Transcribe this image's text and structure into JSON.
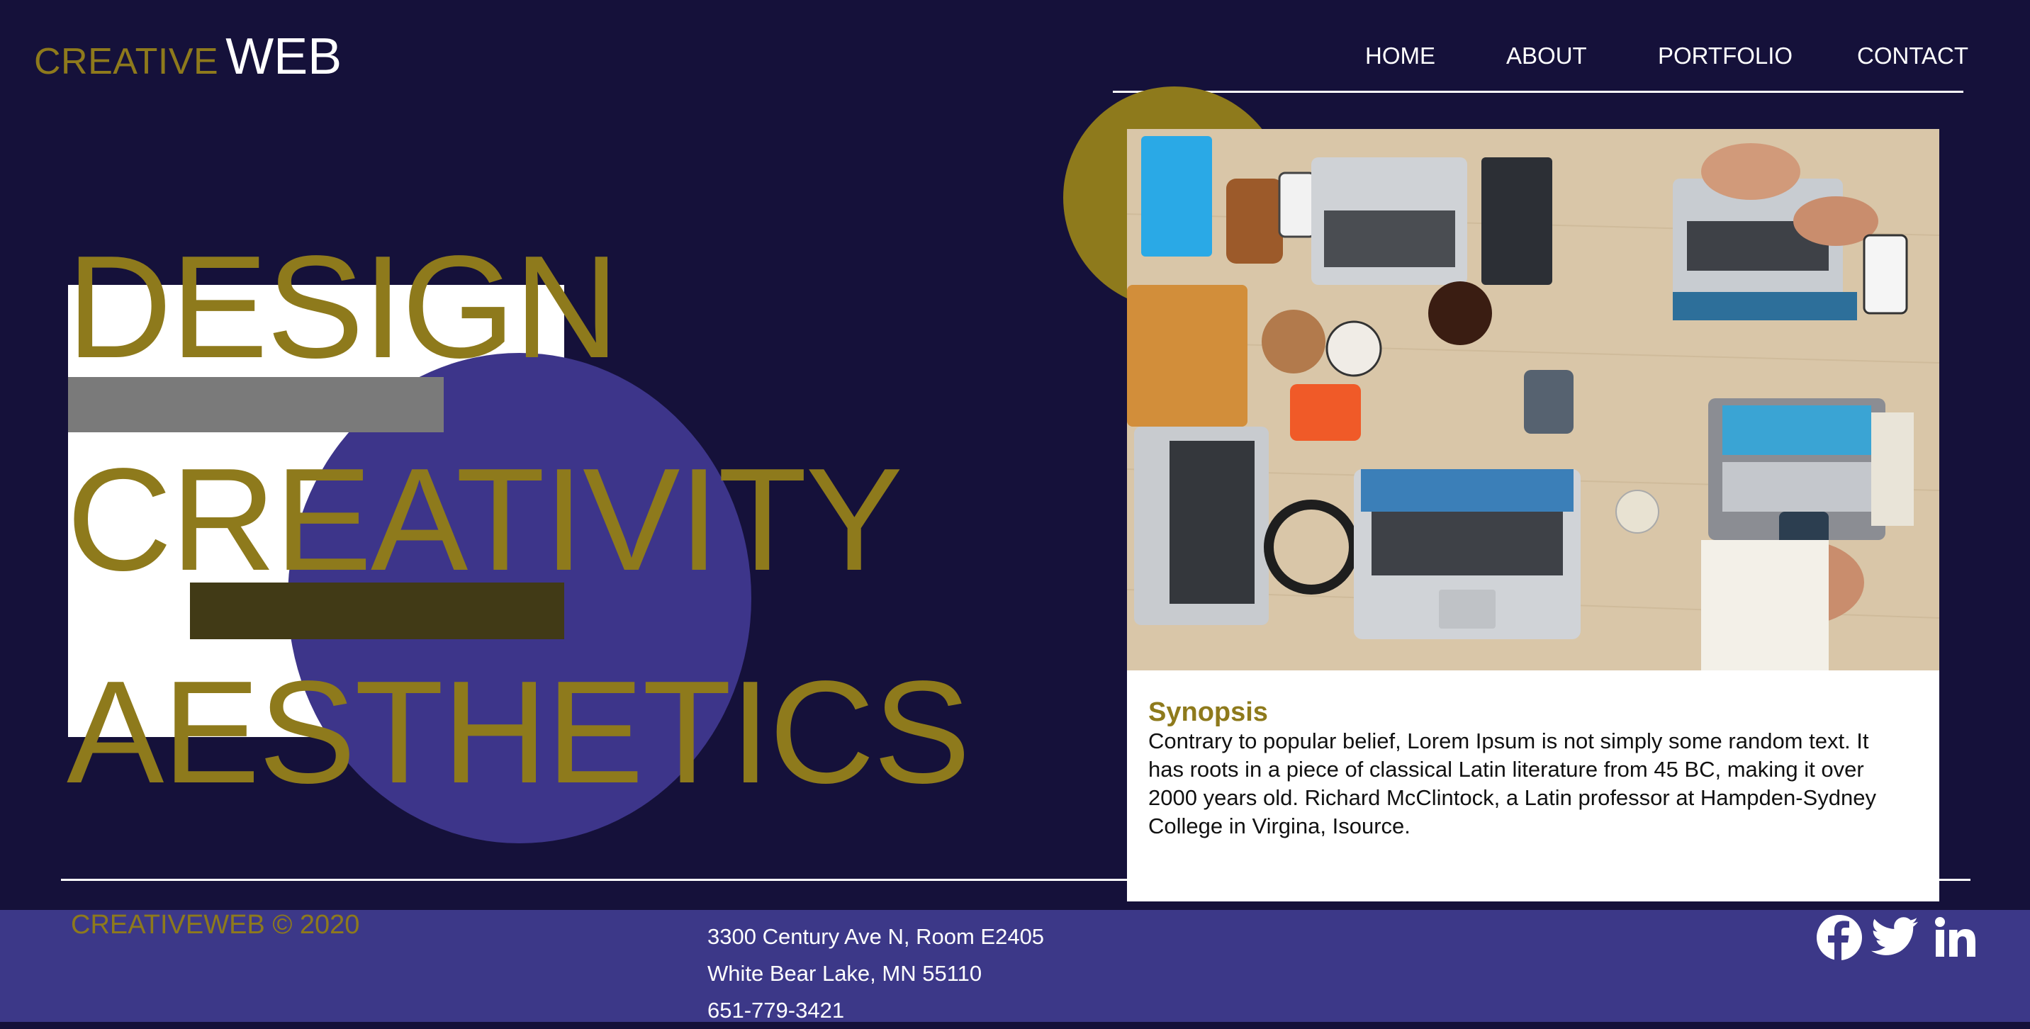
{
  "header": {
    "logo_part1": "CREATIVE",
    "logo_part2": "WEB",
    "nav": [
      "HOME",
      "ABOUT",
      "PORTFOLIO",
      "CONTACT"
    ]
  },
  "hero": {
    "words": [
      "DESIGN",
      "CREATIVITY",
      "AESTHETICS"
    ]
  },
  "card": {
    "title": "Synopsis",
    "body_lines": [
      "Contrary to popular belief, Lorem Ipsum is not simply some random text. It",
      "has roots in a piece of classical Latin literature from 45 BC, making it over",
      "2000 years old. Richard McClintock, a Latin professor at Hampden-Sydney",
      "College in Virgina, Isource."
    ]
  },
  "footer": {
    "copyright": "CREATIVEWEB © 2020",
    "address_lines": [
      "3300 Century Ave N, Room E2405",
      "White Bear Lake, MN 55110",
      "651-779-3421"
    ],
    "social_icons": [
      "facebook-icon",
      "twitter-icon",
      "linkedin-icon"
    ]
  },
  "colors": {
    "background": "#15113a",
    "gold": "#8e7a1c",
    "purple": "#3d358a",
    "footer": "#3c3888",
    "white": "#ffffff"
  }
}
